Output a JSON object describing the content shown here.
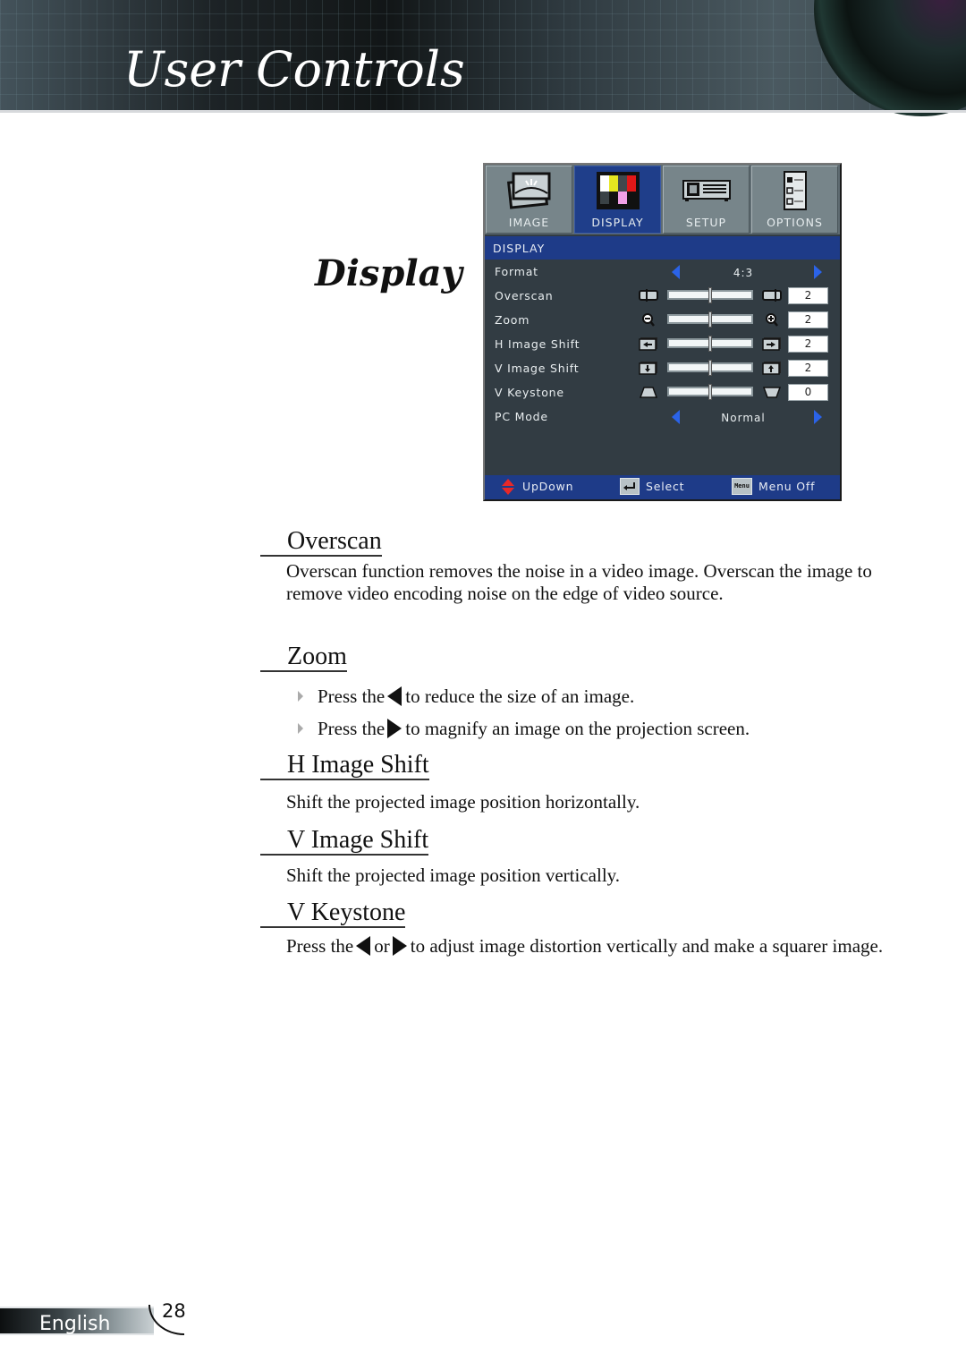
{
  "header": {
    "title": "User Controls"
  },
  "section_title": "Display",
  "osd_menu": {
    "tabs": [
      {
        "label": "IMAGE",
        "icon": "image-icon",
        "active": false
      },
      {
        "label": "DISPLAY",
        "icon": "display-color-bars-icon",
        "active": true
      },
      {
        "label": "SETUP",
        "icon": "projector-icon",
        "active": false
      },
      {
        "label": "OPTIONS",
        "icon": "checklist-icon",
        "active": false
      }
    ],
    "subheader": "DISPLAY",
    "rows": [
      {
        "label": "Format",
        "type": "option",
        "value": "4:3"
      },
      {
        "label": "Overscan",
        "type": "slider",
        "value": "2",
        "level": 0.5,
        "icon_left": "overscan-less-icon",
        "icon_right": "overscan-more-icon"
      },
      {
        "label": "Zoom",
        "type": "slider",
        "value": "2",
        "level": 0.5,
        "icon_left": "zoom-out-icon",
        "icon_right": "zoom-in-icon"
      },
      {
        "label": "H Image Shift",
        "type": "slider",
        "value": "2",
        "level": 0.5,
        "icon_left": "shift-left-icon",
        "icon_right": "shift-right-icon"
      },
      {
        "label": "V Image Shift",
        "type": "slider",
        "value": "2",
        "level": 0.5,
        "icon_left": "shift-down-icon",
        "icon_right": "shift-up-icon"
      },
      {
        "label": "V Keystone",
        "type": "slider",
        "value": "0",
        "level": 0.5,
        "icon_left": "keystone-narrow-top-icon",
        "icon_right": "keystone-narrow-bottom-icon"
      },
      {
        "label": "PC Mode",
        "type": "option",
        "value": "Normal"
      }
    ],
    "footer": {
      "updown": "UpDown",
      "select": "Select",
      "menu_icon_text": "Menu",
      "menu_off": "Menu Off"
    },
    "colors": {
      "panel": "#323c43",
      "accent_blue": "#1e3b88",
      "arrow_blue": "#2b63e8"
    }
  },
  "sections": {
    "overscan": {
      "heading": "Overscan",
      "text": "Overscan function removes the noise in a video image. Overscan the image to remove video encoding noise on the edge of video source."
    },
    "zoom": {
      "heading": "Zoom",
      "bullets": [
        {
          "pre": "Press the",
          "arrow": "left",
          "post": "to reduce the size of an image."
        },
        {
          "pre": "Press the",
          "arrow": "right",
          "post": "to magnify an image on the projection screen."
        }
      ]
    },
    "h_image_shift": {
      "heading": "H Image Shift",
      "text": "Shift the projected image position horizontally."
    },
    "v_image_shift": {
      "heading": "V Image Shift",
      "text": "Shift the projected image position vertically."
    },
    "v_keystone": {
      "heading": "V Keystone",
      "pre": "Press the",
      "mid": "or",
      "post": "to adjust image distortion vertically and make a squarer image."
    }
  },
  "page_footer": {
    "language": "English",
    "page_number": "28"
  }
}
